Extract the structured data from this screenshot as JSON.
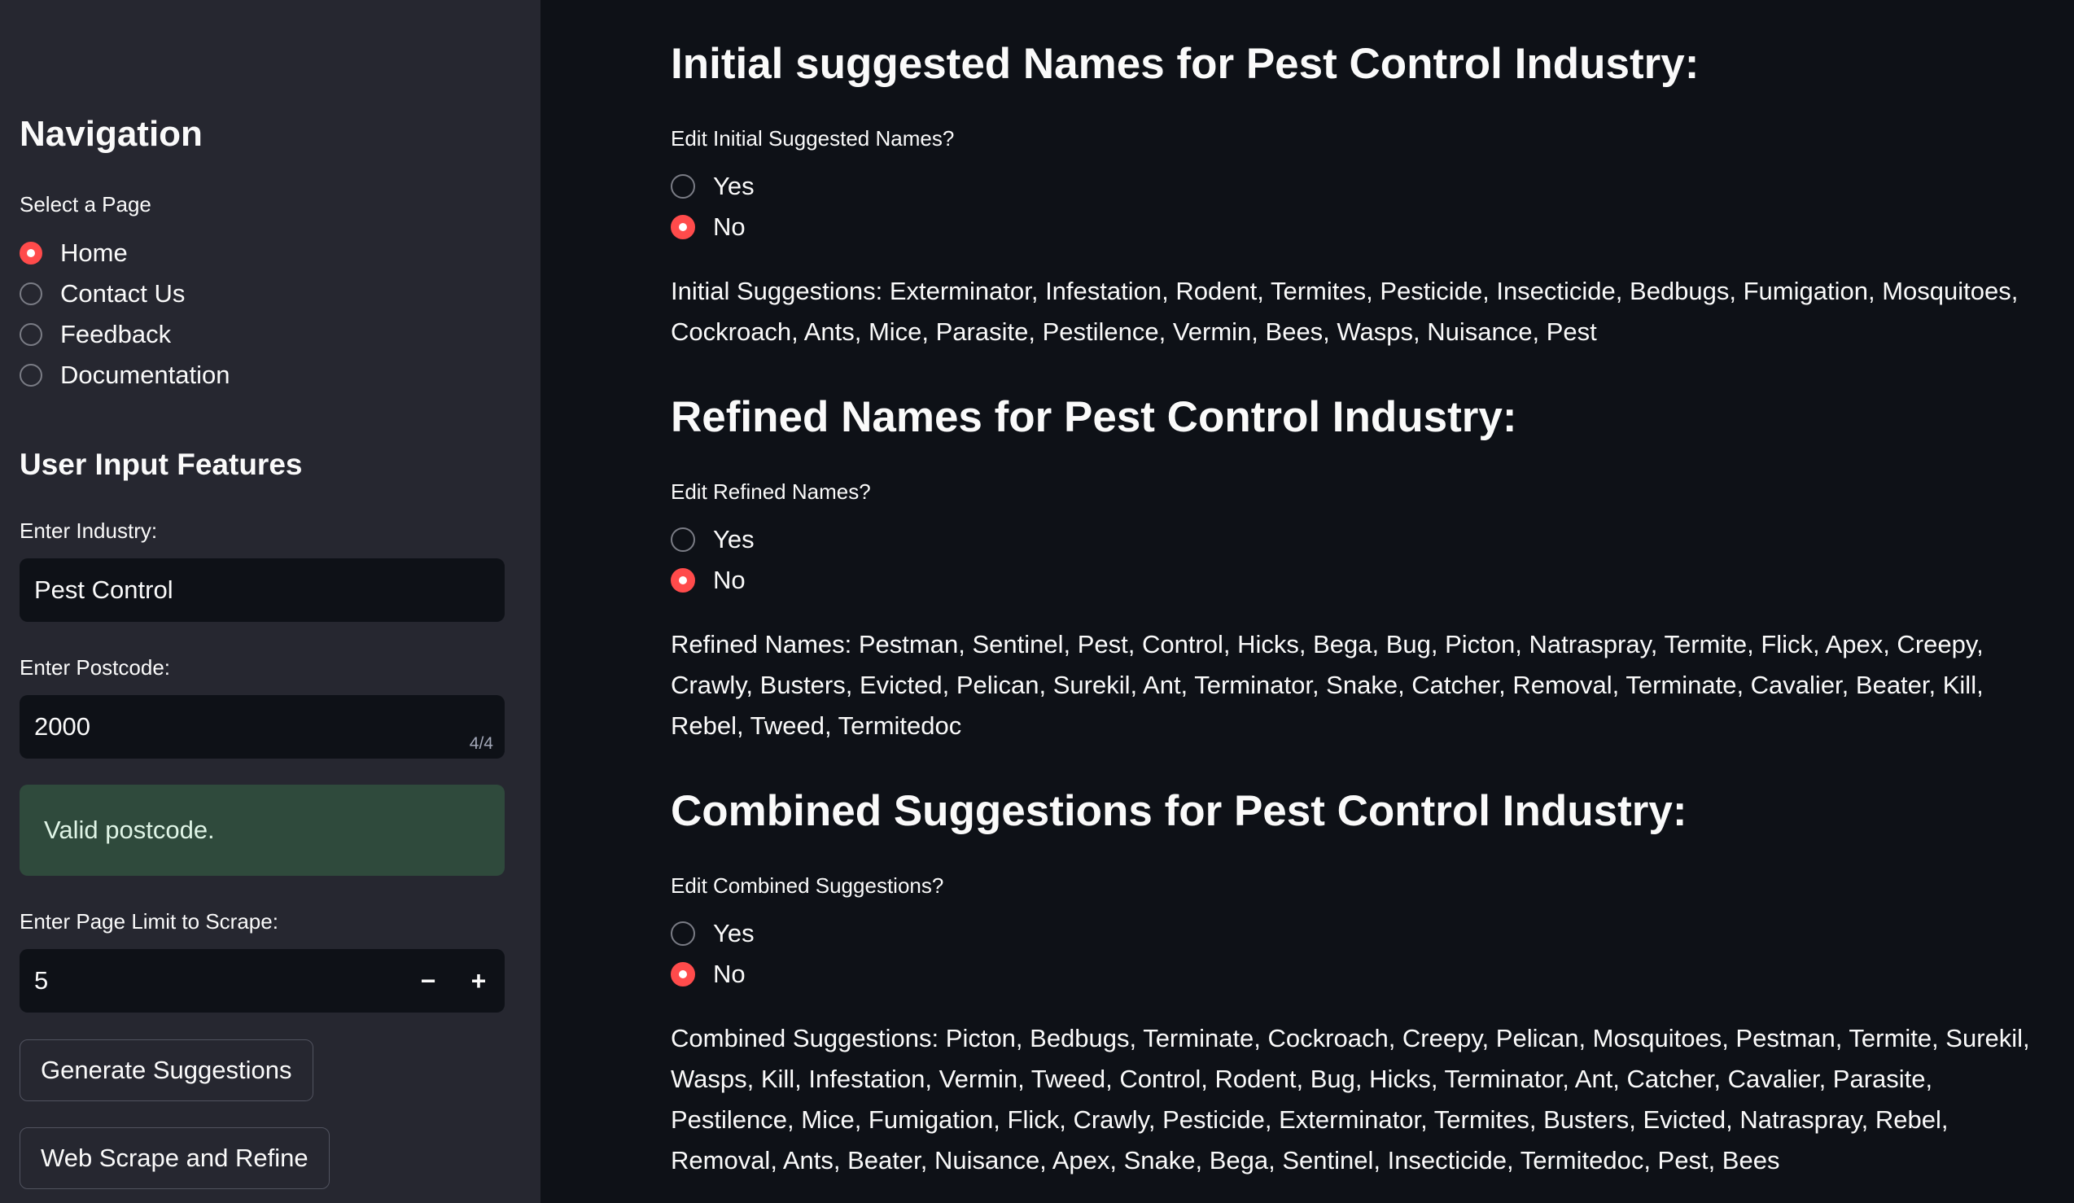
{
  "sidebar": {
    "navigation_title": "Navigation",
    "select_page_label": "Select a Page",
    "pages": [
      {
        "label": "Home",
        "selected": true
      },
      {
        "label": "Contact Us",
        "selected": false
      },
      {
        "label": "Feedback",
        "selected": false
      },
      {
        "label": "Documentation",
        "selected": false
      }
    ],
    "input_features_title": "User Input Features",
    "industry": {
      "label": "Enter Industry:",
      "value": "Pest Control"
    },
    "postcode": {
      "label": "Enter Postcode:",
      "value": "2000",
      "counter": "4/4"
    },
    "postcode_status": "Valid postcode.",
    "page_limit": {
      "label": "Enter Page Limit to Scrape:",
      "value": "5",
      "decrement": "−",
      "increment": "+"
    },
    "generate_button": "Generate Suggestions",
    "scrape_button": "Web Scrape and Refine"
  },
  "main": {
    "sections": [
      {
        "title": "Initial suggested Names for Pest Control Industry:",
        "edit_label": "Edit Initial Suggested Names?",
        "options": [
          "Yes",
          "No"
        ],
        "selected": "No",
        "text": "Initial Suggestions: Exterminator, Infestation, Rodent, Termites, Pesticide, Insecticide, Bedbugs, Fumigation, Mosquitoes, Cockroach, Ants, Mice, Parasite, Pestilence, Vermin, Bees, Wasps, Nuisance, Pest"
      },
      {
        "title": "Refined Names for Pest Control Industry:",
        "edit_label": "Edit Refined Names?",
        "options": [
          "Yes",
          "No"
        ],
        "selected": "No",
        "text": "Refined Names: Pestman, Sentinel, Pest, Control, Hicks, Bega, Bug, Picton, Natraspray, Termite, Flick, Apex, Creepy, Crawly, Busters, Evicted, Pelican, Surekil, Ant, Terminator, Snake, Catcher, Removal, Terminate, Cavalier, Beater, Kill, Rebel, Tweed, Termitedoc"
      },
      {
        "title": "Combined Suggestions for Pest Control Industry:",
        "edit_label": "Edit Combined Suggestions?",
        "options": [
          "Yes",
          "No"
        ],
        "selected": "No",
        "text": "Combined Suggestions: Picton, Bedbugs, Terminate, Cockroach, Creepy, Pelican, Mosquitoes, Pestman, Termite, Surekil, Wasps, Kill, Infestation, Vermin, Tweed, Control, Rodent, Bug, Hicks, Terminator, Ant, Catcher, Cavalier, Parasite, Pestilence, Mice, Fumigation, Flick, Crawly, Pesticide, Exterminator, Termites, Busters, Evicted, Natraspray, Rebel, Removal, Ants, Beater, Nuisance, Apex, Snake, Bega, Sentinel, Insecticide, Termitedoc, Pest, Bees"
      }
    ]
  }
}
